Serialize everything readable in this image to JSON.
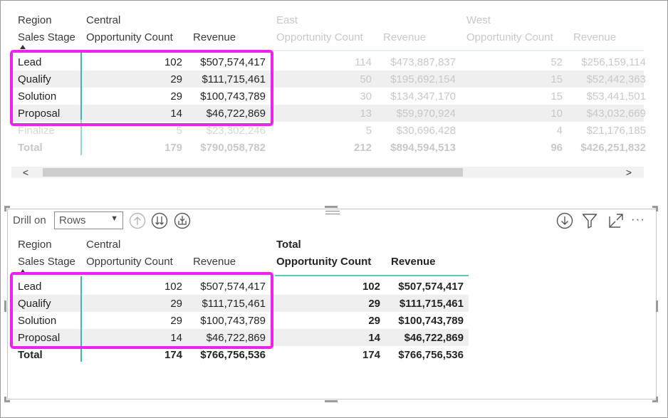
{
  "matrix_top": {
    "header": {
      "region_label": "Region",
      "sales_stage_label": "Sales Stage",
      "regions": [
        {
          "name": "Central",
          "opp_label": "Opportunity Count",
          "rev_label": "Revenue"
        },
        {
          "name": "East",
          "opp_label": "Opportunity Count",
          "rev_label": "Revenue"
        },
        {
          "name": "West",
          "opp_label": "Opportunity Count",
          "rev_label": "Revenue"
        }
      ]
    },
    "rows": [
      {
        "stage": "Lead",
        "central_count": "102",
        "central_revenue": "$507,574,417",
        "east_count": "114",
        "east_revenue": "$473,887,837",
        "west_count": "52",
        "west_revenue": "$256,159,114"
      },
      {
        "stage": "Qualify",
        "central_count": "29",
        "central_revenue": "$111,715,461",
        "east_count": "50",
        "east_revenue": "$195,692,154",
        "west_count": "15",
        "west_revenue": "$52,442,363"
      },
      {
        "stage": "Solution",
        "central_count": "29",
        "central_revenue": "$100,743,789",
        "east_count": "30",
        "east_revenue": "$134,347,170",
        "west_count": "15",
        "west_revenue": "$53,441,501"
      },
      {
        "stage": "Proposal",
        "central_count": "14",
        "central_revenue": "$46,722,869",
        "east_count": "13",
        "east_revenue": "$59,970,924",
        "west_count": "10",
        "west_revenue": "$43,032,669"
      },
      {
        "stage": "Finalize",
        "central_count": "5",
        "central_revenue": "$23,302,246",
        "east_count": "5",
        "east_revenue": "$30,696,428",
        "west_count": "4",
        "west_revenue": "$21,176,185"
      }
    ],
    "total": {
      "label": "Total",
      "central_count": "179",
      "central_revenue": "$790,058,782",
      "east_count": "212",
      "east_revenue": "$894,594,513",
      "west_count": "96",
      "west_revenue": "$426,251,832"
    },
    "scroll": {
      "left_arrow": "<",
      "right_arrow": ">"
    }
  },
  "visual_toolbar": {
    "drill_label": "Drill on",
    "drill_select_value": "Rows",
    "drill_select_arrow": "▼",
    "more_options": "···"
  },
  "matrix_bottom": {
    "header": {
      "region_label": "Region",
      "sales_stage_label": "Sales Stage",
      "central": "Central",
      "total": "Total",
      "opp_label": "Opportunity Count",
      "rev_label": "Revenue"
    },
    "rows": [
      {
        "stage": "Lead",
        "central_count": "102",
        "central_revenue": "$507,574,417",
        "total_count": "102",
        "total_revenue": "$507,574,417"
      },
      {
        "stage": "Qualify",
        "central_count": "29",
        "central_revenue": "$111,715,461",
        "total_count": "29",
        "total_revenue": "$111,715,461"
      },
      {
        "stage": "Solution",
        "central_count": "29",
        "central_revenue": "$100,743,789",
        "total_count": "29",
        "total_revenue": "$100,743,789"
      },
      {
        "stage": "Proposal",
        "central_count": "14",
        "central_revenue": "$46,722,869",
        "total_count": "14",
        "total_revenue": "$46,722,869"
      }
    ],
    "total": {
      "label": "Total",
      "central_count": "174",
      "central_revenue": "$766,756,536",
      "total_count": "174",
      "total_revenue": "$766,756,536"
    }
  },
  "colors": {
    "highlight": "#ee22ee",
    "accent_teal": "#3bb8b0",
    "row_band": "#efefef",
    "faded_text": "#c8c8c8"
  },
  "icons": [
    "sort-ascending-icon",
    "drill-up-icon",
    "drill-down-next-level-icon",
    "expand-all-icon",
    "drill-mode-icon",
    "filter-icon",
    "focus-mode-icon",
    "more-options-icon"
  ]
}
